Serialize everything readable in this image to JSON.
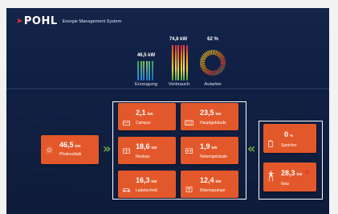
{
  "header": {
    "logo": "POHL",
    "subtitle": "Energie Management System"
  },
  "summary": {
    "erzeugung": {
      "value": "46,5",
      "unit": "kW",
      "label": "Erzeugung"
    },
    "verbrauch": {
      "value": "74,8",
      "unit": "kW",
      "label": "Verbrauch"
    },
    "autarkie": {
      "value": "62",
      "unit": "%",
      "label": "Autarkie",
      "fraction": 0.62
    }
  },
  "source": {
    "value": "46,5",
    "unit": "kW",
    "label": "Photovoltaik"
  },
  "consumers": [
    {
      "value": "2,1",
      "unit": "kW",
      "label": "Campus",
      "icon": "campus-icon"
    },
    {
      "value": "23,5",
      "unit": "kW",
      "label": "Hauptgebäude",
      "icon": "main-building-icon"
    },
    {
      "value": "18,6",
      "unit": "kW",
      "label": "Neubau",
      "icon": "new-building-icon"
    },
    {
      "value": "1,9",
      "unit": "kW",
      "label": "Nebengebäude",
      "icon": "side-building-icon"
    },
    {
      "value": "16,3",
      "unit": "kW",
      "label": "Ladetechnik",
      "icon": "ev-charging-icon"
    },
    {
      "value": "12,4",
      "unit": "kW",
      "label": "Wärmepumpe",
      "icon": "heat-pump-icon"
    }
  ],
  "storage": {
    "value": "0",
    "unit": "%",
    "label": "Speicher",
    "icon": "battery-icon"
  },
  "grid": {
    "value": "28,3",
    "unit": "kW",
    "label": "Netz",
    "icon": "power-pylon-icon"
  },
  "colors": {
    "tile": "#e3582a",
    "background": "#102044",
    "flow_in": "#6fae3b",
    "flow_out": "#e0342c"
  }
}
